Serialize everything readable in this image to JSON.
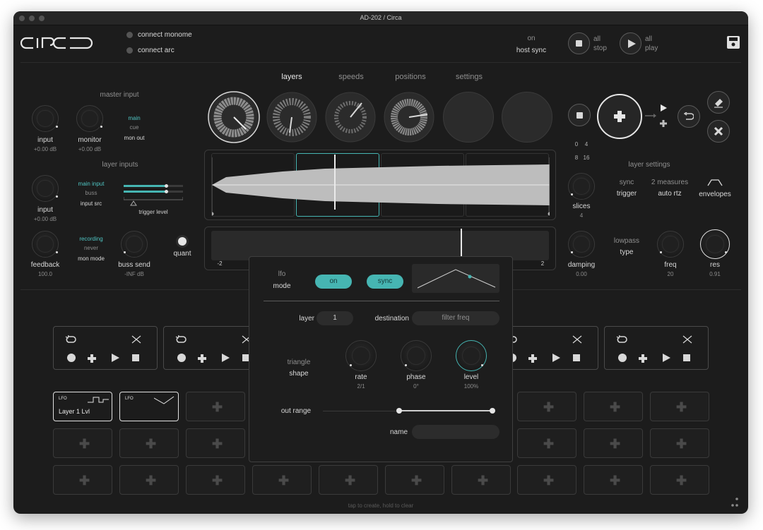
{
  "window": {
    "title": "AD-202 / Circa"
  },
  "header": {
    "logo": "circa",
    "connect_monome": "connect monome",
    "connect_arc": "connect arc",
    "sync_state": "on",
    "sync_label": "host sync",
    "all_stop": "all\nstop",
    "all_stop_1": "all",
    "all_stop_2": "stop",
    "all_play_1": "all",
    "all_play_2": "play"
  },
  "tabs": [
    "layers",
    "speeds",
    "positions",
    "settings"
  ],
  "master_input": {
    "title": "master input",
    "input_label": "input",
    "input_value": "+0.00 dB",
    "monitor_label": "monitor",
    "monitor_value": "+0.00 dB",
    "route_main": "main",
    "route_cue": "cue",
    "route_label": "mon out"
  },
  "layer_inputs": {
    "title": "layer inputs",
    "input_label": "input",
    "input_value": "+0.00 dB",
    "src_main": "main input",
    "src_buss": "buss",
    "src_label": "input src",
    "trigger_label": "trigger level",
    "feedback_label": "feedback",
    "feedback_value": "100.0",
    "mon_recording": "recording",
    "mon_never": "never",
    "mon_label": "mon mode",
    "buss_label": "buss send",
    "buss_value": "-INF dB",
    "quant_label": "quant"
  },
  "scrub": {
    "min": "-2",
    "max": "2"
  },
  "right_panel": {
    "grid_0": "0",
    "grid_4": "4",
    "grid_8": "8",
    "grid_16": "16",
    "layer_settings_title": "layer settings",
    "slices_label": "slices",
    "slices_value": "4",
    "sync_mode": "sync",
    "sync_value": "trigger",
    "measures": "2 measures",
    "measures_value": "auto rtz",
    "envelopes": "envelopes",
    "damping_label": "damping",
    "damping_value": "0.00",
    "filter_mode": "lowpass",
    "filter_type": "type",
    "freq_label": "freq",
    "freq_value": "20",
    "res_label": "res",
    "res_value": "0.91"
  },
  "lfo_slots": [
    {
      "tag": "LFO",
      "name": "Layer 1 Lvl"
    },
    {
      "tag": "LFO",
      "name": ""
    }
  ],
  "modal": {
    "lfo": "lfo",
    "mode": "mode",
    "on_label": "on",
    "sync_label": "sync",
    "layer_label": "layer",
    "layer_value": "1",
    "destination_label": "destination",
    "destination_value": "filter freq",
    "shape_name": "triangle",
    "shape_label": "shape",
    "rate_label": "rate",
    "rate_value": "2/1",
    "phase_label": "phase",
    "phase_value": "0°",
    "level_label": "level",
    "level_value": "100%",
    "out_range_label": "out range",
    "out_range_low": 0.45,
    "out_range_high": 1.0,
    "name_label": "name",
    "name_value": ""
  },
  "footer": {
    "hint": "tap to create, hold to clear"
  },
  "colors": {
    "accent": "#46b5b2",
    "bg": "#1c1c1c"
  }
}
